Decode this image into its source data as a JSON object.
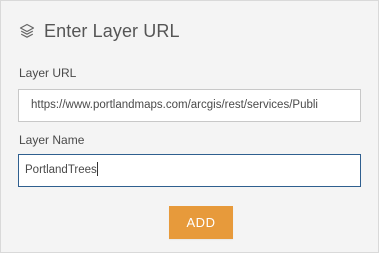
{
  "header": {
    "icon": "layers-icon",
    "title": "Enter Layer URL"
  },
  "form": {
    "url_label": "Layer URL",
    "url_value": "https://www.portlandmaps.com/arcgis/rest/services/Publi",
    "name_label": "Layer Name",
    "name_value": "PortlandTrees"
  },
  "actions": {
    "add_label": "ADD"
  },
  "colors": {
    "background": "#f4f4f4",
    "accent": "#e79a3b",
    "focus_border": "#2f5f8f"
  }
}
